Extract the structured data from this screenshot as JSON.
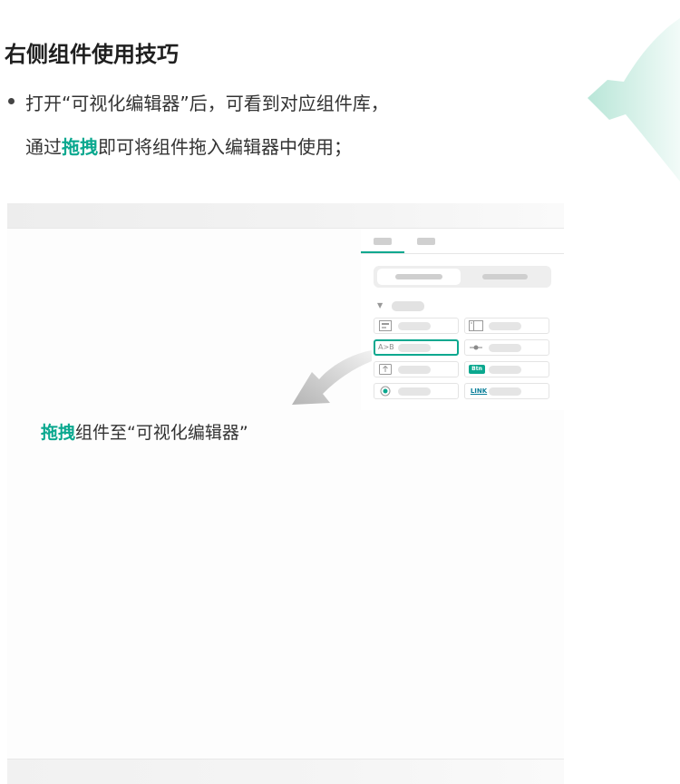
{
  "heading": "右侧组件使用技巧",
  "tip": {
    "line1": "打开“可视化编辑器”后，可看到对应组件库，",
    "line2_pre": "通过",
    "line2_hl": "拖拽",
    "line2_post": "即可将组件拖入编辑器中使用；"
  },
  "caption": {
    "hl": "拖拽",
    "rest": "组件至“可视化编辑器”"
  },
  "components": {
    "icons": [
      "form-icon",
      "layout-icon",
      "ab-icon",
      "slider-icon",
      "upload-icon",
      "button-icon",
      "radio-icon",
      "link-icon"
    ],
    "icon_text": {
      "ab": "A>B",
      "btn": "Btn",
      "link": "LINK"
    },
    "selected": "ab-icon"
  },
  "colors": {
    "accent": "#0aa88f",
    "deco": "#cfeee5"
  }
}
